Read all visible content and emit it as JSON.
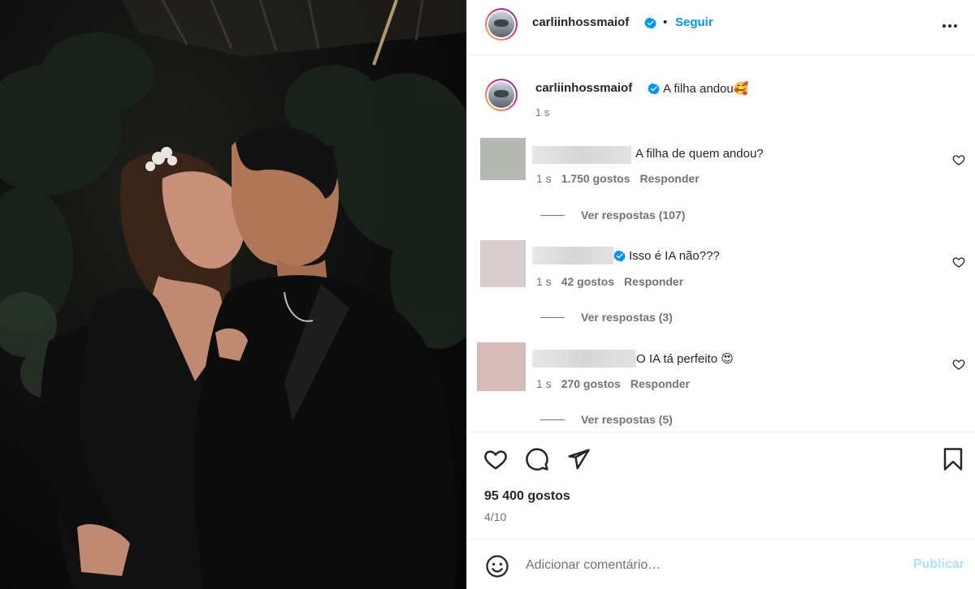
{
  "post": {
    "author": "carliinhossmaiof",
    "dot": "•",
    "follow_label": "Seguir",
    "caption": {
      "username": "carliinhossmaiof",
      "text": "A filha andou🥰",
      "time": "1 s"
    },
    "comments": [
      {
        "text": "A filha de quem andou?",
        "time": "1 s",
        "likes": "1.750 gostos",
        "reply_label": "Responder",
        "view_replies": "Ver respostas (107)",
        "avatar_color": "#b4bab2"
      },
      {
        "text": "Isso é IA não???",
        "time": "1 s",
        "likes": "42 gostos",
        "reply_label": "Responder",
        "view_replies": "Ver respostas (3)",
        "avatar_color": "#d9cdcd",
        "verified": true
      },
      {
        "text": "O IA tá perfeito 😍",
        "time": "1 s",
        "likes": "270 gostos",
        "reply_label": "Responder",
        "view_replies": "Ver respostas (5)",
        "avatar_color": "#d5bcb8"
      }
    ],
    "likes_count": "95 400 gostos",
    "image_counter": "4/10",
    "comment_placeholder": "Adicionar comentário…",
    "publish_label": "Publicar"
  },
  "icons": {
    "verified": "verified-badge-icon",
    "more": "more-options-icon",
    "like": "heart-icon",
    "comment": "comment-bubble-icon",
    "share": "paper-plane-icon",
    "save": "bookmark-icon",
    "emoji": "smiley-icon"
  },
  "colors": {
    "accent": "#0095f6",
    "publish_disabled": "#b2dffc",
    "muted": "#737373"
  }
}
